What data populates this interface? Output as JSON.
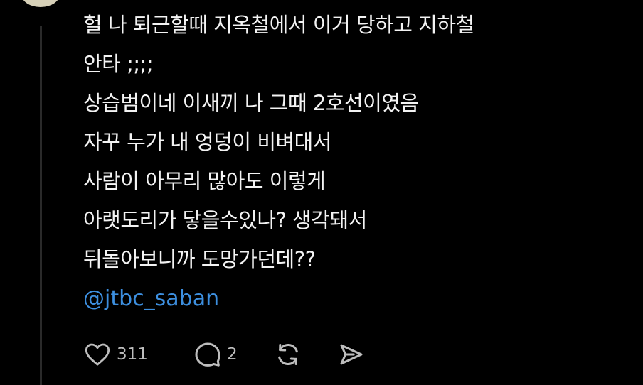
{
  "post": {
    "lines": [
      "헐 나 퇴근할때 지옥철에서 이거 당하고 지하철",
      "안타 ;;;;",
      "상습범이네 이새끼 나 그때 2호선이였음",
      "자꾸 누가 내 엉덩이 비벼대서",
      "사람이 아무리 많아도 이렇게",
      "아랫도리가 닿을수있나? 생각돼서",
      "뒤돌아보니까 도망가던데??"
    ],
    "mention": "@jtbc_saban"
  },
  "actions": {
    "likes": "311",
    "replies": "2",
    "like_icon": "heart-icon",
    "reply_icon": "speech-bubble-icon",
    "repost_icon": "repost-icon",
    "share_icon": "send-icon"
  },
  "colors": {
    "background": "#000000",
    "text": "#f3f3f3",
    "mention": "#3d8fdf",
    "icon": "#bdbdbd"
  }
}
